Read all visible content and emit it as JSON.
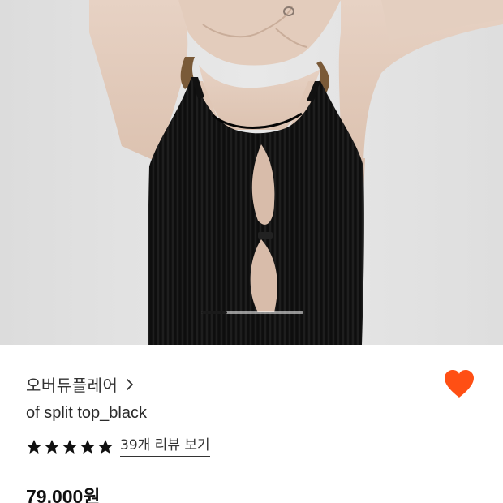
{
  "product_image": {
    "alt_subject": "model wearing black knit halter top with front cutouts",
    "carousel": {
      "current_fraction": 0.25
    }
  },
  "brand": {
    "name": "오버듀플레어",
    "chevron_icon": "chevron-right-icon"
  },
  "wishlist": {
    "icon": "heart-icon",
    "active": true,
    "color": "#ff4f14"
  },
  "product": {
    "name": "of split top_black",
    "price": "79,000원"
  },
  "rating": {
    "stars": 5,
    "max_stars": 5,
    "review_link": "39개 리뷰 보기"
  }
}
